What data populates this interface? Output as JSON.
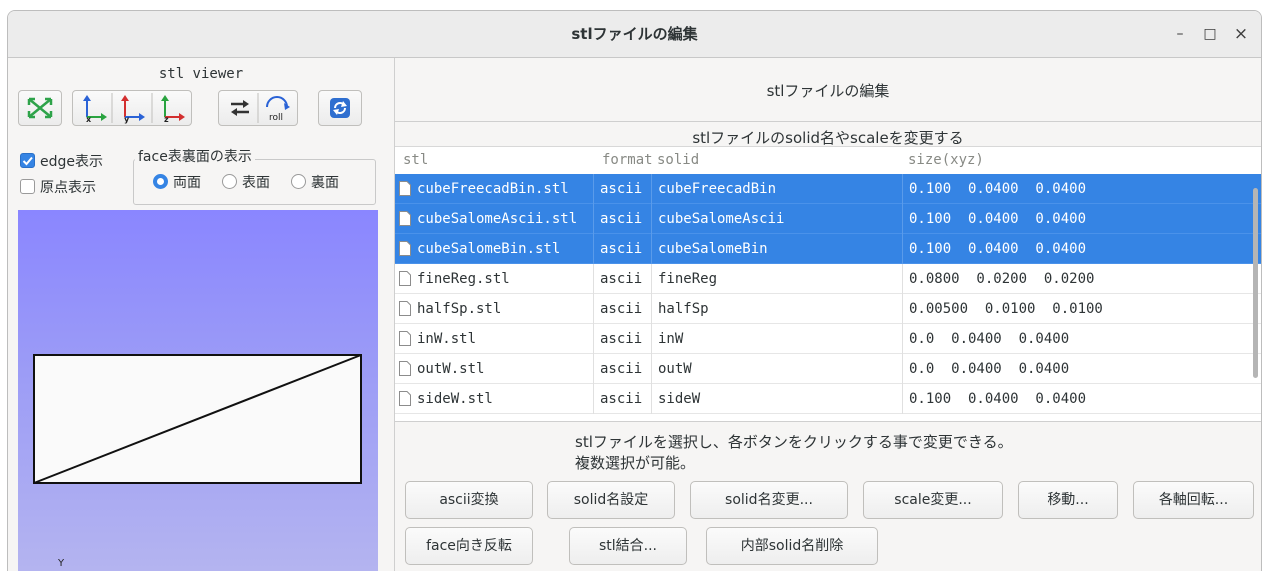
{
  "window": {
    "title": "stlファイルの編集",
    "controls": [
      "–",
      "□",
      "×"
    ]
  },
  "left": {
    "viewer_title": "stl viewer",
    "toolbar": [
      {
        "name": "fit-view-icon"
      },
      {
        "name": "x-axis-view-icon"
      },
      {
        "name": "y-axis-view-icon"
      },
      {
        "name": "z-axis-view-icon"
      },
      {
        "name": "swap-icon"
      },
      {
        "name": "roll-icon",
        "text": "roll"
      },
      {
        "name": "reload-icon"
      }
    ],
    "edge_label": "edge表示",
    "edge_checked": true,
    "origin_label": "原点表示",
    "origin_checked": false,
    "face_group_title": "face表裏面の表示",
    "radios": [
      {
        "label": "両面",
        "checked": true
      },
      {
        "label": "表面",
        "checked": false
      },
      {
        "label": "裏面",
        "checked": false
      }
    ],
    "axis_glyph": "Y"
  },
  "right": {
    "header": "stlファイルの編集",
    "subheader": "stlファイルのsolid名やscaleを変更する",
    "columns": [
      "stl",
      "format",
      "solid",
      "size(xyz)"
    ],
    "rows": [
      {
        "stl": "cubeFreecadBin.stl",
        "format": "ascii",
        "solid": "cubeFreecadBin",
        "size": "0.100  0.0400  0.0400",
        "selected": true
      },
      {
        "stl": "cubeSalomeAscii.stl",
        "format": "ascii",
        "solid": "cubeSalomeAscii",
        "size": "0.100  0.0400  0.0400",
        "selected": true
      },
      {
        "stl": "cubeSalomeBin.stl",
        "format": "ascii",
        "solid": "cubeSalomeBin",
        "size": "0.100  0.0400  0.0400",
        "selected": true
      },
      {
        "stl": "fineReg.stl",
        "format": "ascii",
        "solid": "fineReg",
        "size": "0.0800  0.0200  0.0200",
        "selected": false
      },
      {
        "stl": "halfSp.stl",
        "format": "ascii",
        "solid": "halfSp",
        "size": "0.00500  0.0100  0.0100",
        "selected": false
      },
      {
        "stl": "inW.stl",
        "format": "ascii",
        "solid": "inW",
        "size": "0.0  0.0400  0.0400",
        "selected": false
      },
      {
        "stl": "outW.stl",
        "format": "ascii",
        "solid": "outW",
        "size": "0.0  0.0400  0.0400",
        "selected": false
      },
      {
        "stl": "sideW.stl",
        "format": "ascii",
        "solid": "sideW",
        "size": "0.100  0.0400  0.0400",
        "selected": false
      }
    ],
    "info_line1": "stlファイルを選択し、各ボタンをクリックする事で変更できる。",
    "info_line2": "複数選択が可能。",
    "buttons_row1": [
      "ascii変換",
      "solid名設定",
      "solid名変更...",
      "scale変更...",
      "移動...",
      "各軸回転..."
    ],
    "buttons_row2": [
      "face向き反転",
      "stl結合...",
      "内部solid名削除"
    ]
  }
}
